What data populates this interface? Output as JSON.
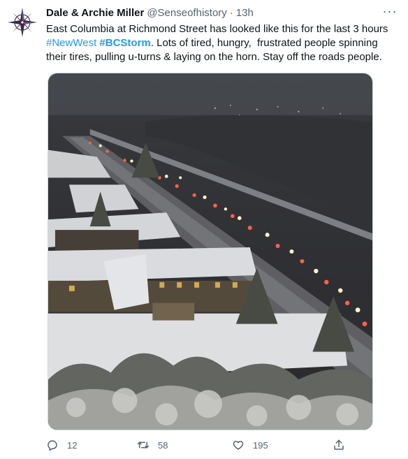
{
  "tweet": {
    "author": {
      "display_name": "Dale & Archie Miller",
      "handle": "@Senseofhistory",
      "separator": "·",
      "time": "13h",
      "avatar_icon": "compass-rose-icon"
    },
    "more_icon": "more-horizontal-icon",
    "text": {
      "line1": "East Columbia at Richmond Street has looked like this for the last 3 hours",
      "hashtag1": "#NewWest",
      "hashtag2": "#BCStorm",
      "after_hashtags": ". Lots of tired, hungry,  frustrated people spinning their tires, pulling u-turns & laying on the horn. Stay off the roads people."
    },
    "actions": {
      "reply_count": "12",
      "retweet_count": "58",
      "like_count": "195"
    }
  },
  "colors": {
    "hashtag": "#1d9bf0",
    "secondary_text": "#536471",
    "primary_text": "#0f1419"
  }
}
